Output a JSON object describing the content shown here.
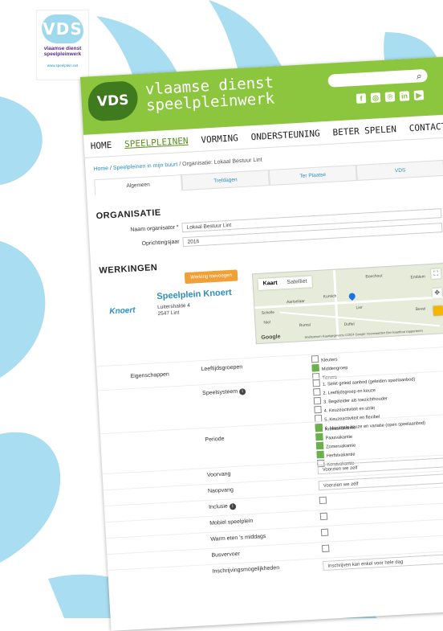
{
  "logo": {
    "big": "VDS",
    "line1": "vlaamse dienst",
    "line2": "speelpleinwerk",
    "url": "www.speelplein.net"
  },
  "header": {
    "brand_line1": "vlaamse dienst",
    "brand_line2": "speelpleinwerk",
    "logo_text": "VDS",
    "search_placeholder": "",
    "social": [
      "f",
      "◎",
      "℗",
      "in",
      "▶"
    ]
  },
  "nav": [
    "HOME",
    "SPEELPLEINEN",
    "VORMING",
    "ONDERSTEUNING",
    "BETER SPELEN",
    "CONTACT"
  ],
  "breadcrumb": {
    "home": "Home",
    "sep1": " / ",
    "mid": "Speelpleinen in mijn buurt",
    "sep2": " / ",
    "current": "Organisatie: Lokaal Bestuur Lint"
  },
  "tabs": [
    "Algemeen",
    "Trefdagen",
    "Ter Plaatse",
    "VDS"
  ],
  "organisatie": {
    "title": "ORGANISATIE",
    "naam_label": "Naam organisator *",
    "naam_value": "Lokaal Bestuur Lint",
    "jaar_label": "Oprichtingsjaar",
    "jaar_value": "2016"
  },
  "werkingen": {
    "title": "WERKINGEN",
    "button": "Werking toevoegen",
    "plein_name": "Speelplein Knoert",
    "plein_logo": "Knoert",
    "address_line1": "Luitershalde 4",
    "address_line2": "2547 Lint",
    "map": {
      "tab_kaart": "Kaart",
      "tab_satelliet": "Satelliet",
      "google": "Google",
      "places": [
        "Boechout",
        "Aartselaar",
        "Kontich",
        "Lier",
        "Schelle",
        "Niel",
        "Rumst",
        "Duffel",
        "Emblem",
        "Bevel"
      ],
      "footer": "Sneltoetsen  Kaartgegevens ©2024 Google  Voorwaarden  Een kaartfout rapporteren"
    }
  },
  "eigenschappen_label": "Eigenschappen",
  "leeftijd": {
    "label": "Leeftijdsgroepen",
    "options": [
      {
        "text": "Kleuters",
        "checked": false
      },
      {
        "text": "Middengroep",
        "checked": true
      },
      {
        "text": "Tieners",
        "checked": false
      }
    ]
  },
  "speelsysteem": {
    "label": "Speelsysteem",
    "info": "i",
    "options": [
      {
        "text": "1. Strikt geleid aanbod (geleiden speelaanbod)",
        "checked": false
      },
      {
        "text": "2. Leeftijdsgroep en keuze",
        "checked": false
      },
      {
        "text": "3. Begeleider als toezichthouder",
        "checked": false
      },
      {
        "text": "4. Keuzeactiviteit en strikt",
        "checked": false
      },
      {
        "text": "5. Keuzeactiviteit en flexibel",
        "checked": false
      },
      {
        "text": "6. Maximale keuze en variatie (open speelaanbod)",
        "checked": false
      }
    ]
  },
  "periode": {
    "label": "Periode",
    "options": [
      {
        "text": "Krokusvakantie",
        "checked": true
      },
      {
        "text": "Paasvakantie",
        "checked": true
      },
      {
        "text": "Zomervakantie",
        "checked": true
      },
      {
        "text": "Herfstvakantie",
        "checked": true
      },
      {
        "text": "Kerstvakantie",
        "checked": false
      }
    ]
  },
  "fields": {
    "vooropvang": {
      "label": "Voorvang",
      "value": "Voorzien we zelf"
    },
    "naopvang": {
      "label": "Naopvang",
      "value": "Voorzien we zelf"
    },
    "inclusie": {
      "label": "Inclusie",
      "info": "i"
    },
    "mobiel": {
      "label": "Mobiel speelplein"
    },
    "warm_eten": {
      "label": "Warm eten 's middags"
    },
    "busvervoer": {
      "label": "Busvervoer"
    },
    "inschrijving": {
      "label": "Inschrijvingsmogelijkheden",
      "value": "Inschrijven kan enkel voor hele dag"
    }
  }
}
